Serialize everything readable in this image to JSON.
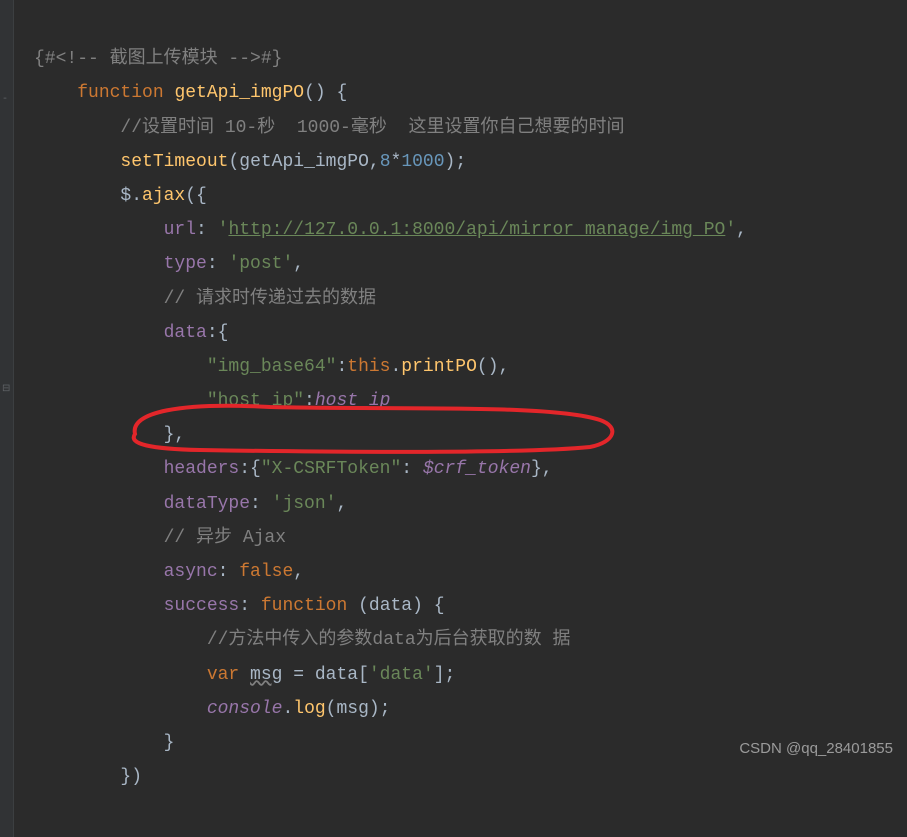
{
  "code": {
    "l1_open": "{#<!-- ",
    "l1_text": "截图上传模块",
    "l1_close": " -->#}",
    "l2_kw": "function ",
    "l2_fn": "getApi_imgPO",
    "l2_rest": "() {",
    "l3_cmt": "//设置时间 10-秒  1000-毫秒  这里设置你自己想要的时间",
    "l4_fn": "setTimeout",
    "l4_a": "(",
    "l4_arg": "getApi_imgPO",
    "l4_b": ",",
    "l4_n1": "8",
    "l4_c": "*",
    "l4_n2": "1000",
    "l4_d": ");",
    "l5_a": "$.",
    "l5_fn": "ajax",
    "l5_b": "({",
    "l6_k": "url",
    "l6_a": ": ",
    "l6_q": "'",
    "l6_url": "http://127.0.0.1:8000/api/mirror_manage/img_PO",
    "l6_b": "',",
    "l7_k": "type",
    "l7_a": ": ",
    "l7_v": "'post'",
    "l7_b": ",",
    "l8_cmt": "// 请求时传递过去的数据",
    "l9_k": "data",
    "l9_a": ":{",
    "l10_k": "\"img_base64\"",
    "l10_a": ":",
    "l10_this": "this",
    "l10_b": ".",
    "l10_fn": "printPO",
    "l10_c": "(),",
    "l11_k": "\"host_ip\"",
    "l11_a": ":",
    "l11_v": "host_ip",
    "l12": "},",
    "l13_k": "headers",
    "l13_a": ":{",
    "l13_key": "\"X-CSRFToken\"",
    "l13_b": ": ",
    "l13_v": "$crf_token",
    "l13_c": "},",
    "l14_k": "dataType",
    "l14_a": ": ",
    "l14_v": "'json'",
    "l14_b": ",",
    "l15_cmt": "// 异步 Ajax",
    "l16_k": "async",
    "l16_a": ": ",
    "l16_v": "false",
    "l16_b": ",",
    "l17_k": "success",
    "l17_a": ": ",
    "l17_kw": "function ",
    "l17_b": "(",
    "l17_arg": "data",
    "l17_c": ") {",
    "l18_cmt": "//方法中传入的参数data为后台获取的数 据",
    "l19_kw": "var ",
    "l19_v": "msg",
    "l19_a": " = data[",
    "l19_s": "'data'",
    "l19_b": "];",
    "l20_c": "console",
    "l20_a": ".",
    "l20_fn": "log",
    "l20_b": "(msg);",
    "l21": "}",
    "l22": "})"
  },
  "watermark": "CSDN @qq_28401855"
}
